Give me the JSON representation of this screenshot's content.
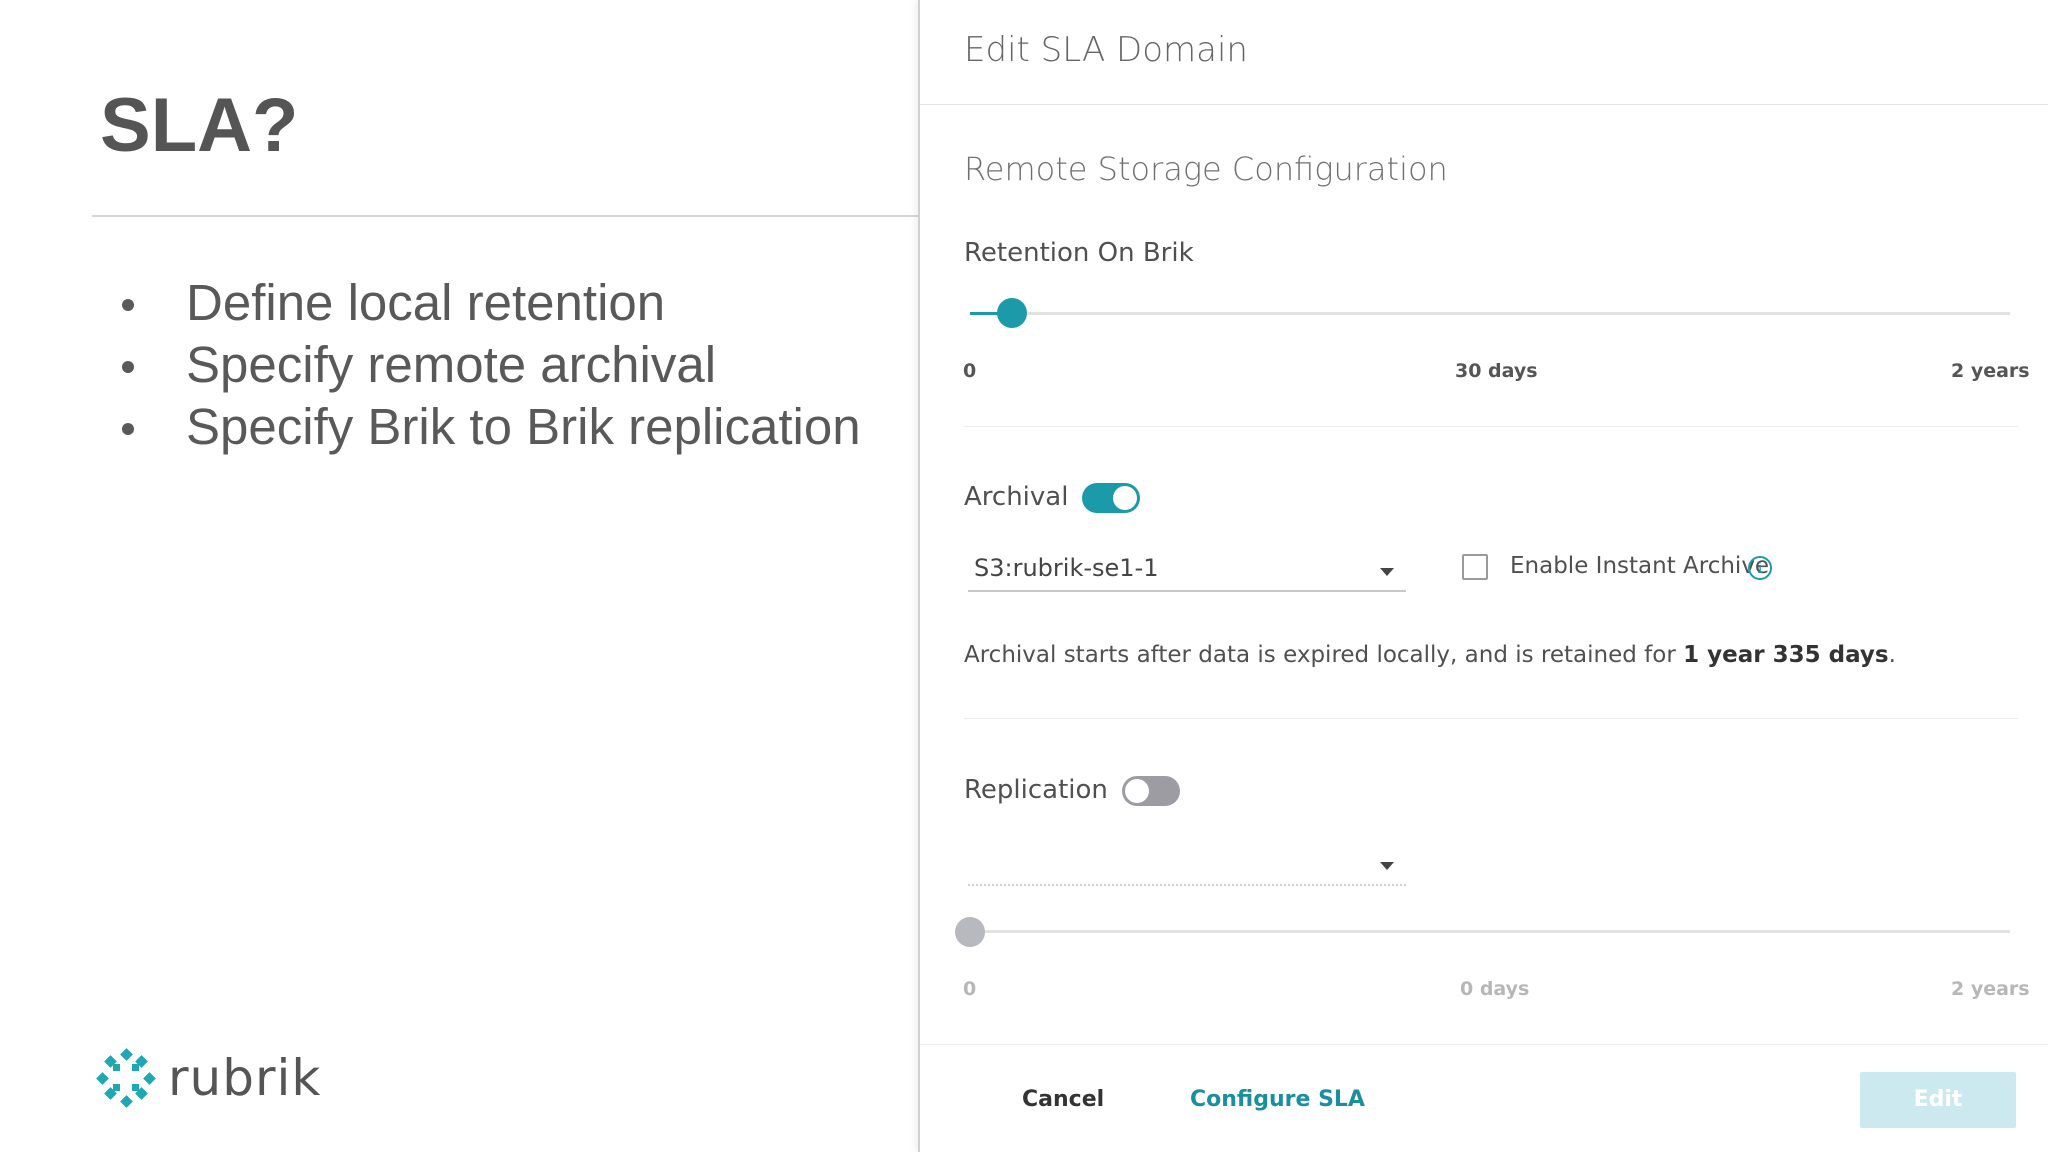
{
  "slide": {
    "title": "SLA?",
    "bullets": [
      "Define local retention",
      "Specify remote archival",
      "Specify Brik to Brik replication"
    ],
    "logo_text": "rubrik"
  },
  "dialog": {
    "title": "Edit SLA Domain",
    "section_title": "Remote Storage Configuration",
    "retention": {
      "label": "Retention On Brik",
      "value_fraction": 0.04,
      "tick_min": "0",
      "tick_mid": "30 days",
      "tick_max": "2 years"
    },
    "archival": {
      "label": "Archival",
      "enabled": true,
      "target_value": "S3:rubrik-se1-1",
      "instant_archive_label": "Enable Instant Archive",
      "instant_archive_checked": false,
      "summary_prefix": "Archival starts after data is expired locally, and is retained for ",
      "summary_bold": "1 year 335 days",
      "summary_suffix": "."
    },
    "replication": {
      "label": "Replication",
      "enabled": false,
      "target_value": "",
      "value_fraction": 0,
      "tick_min": "0",
      "tick_mid": "0 days",
      "tick_max": "2 years"
    },
    "footer": {
      "cancel_label": "Cancel",
      "configure_label": "Configure SLA",
      "edit_label": "Edit"
    }
  },
  "colors": {
    "accent": "#1b9aaa",
    "text": "#555555",
    "disabled_button": "#cbe9ee"
  },
  "icons": {
    "info": "info-icon",
    "caret": "chevron-down-icon",
    "logo": "rubrik-logo-icon"
  }
}
